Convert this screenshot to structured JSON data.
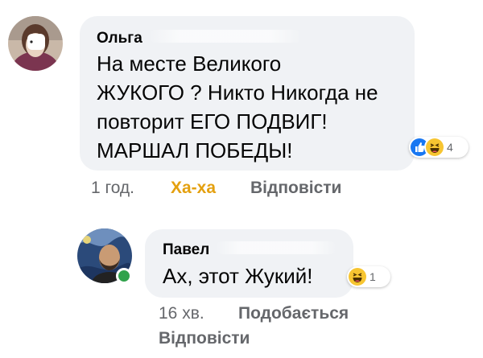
{
  "comments": [
    {
      "author": "Ольга",
      "text_lines": [
        "На месте Великого",
        "ЖУКОГО ? Никто Никогда не",
        "повторит ЕГО ПОДВИГ!",
        "МАРШАЛ ПОБЕДЫ!"
      ],
      "time": "1 год.",
      "reaction_label": "Ха-ха",
      "reply_label": "Відповісти",
      "reactions": {
        "icons": [
          "like-icon",
          "haha-icon"
        ],
        "count": "4"
      }
    },
    {
      "author": "Павел",
      "text": "Ах, этот Жукий!",
      "time": "16 хв.",
      "like_label": "Подобається",
      "reply_label": "Відповісти",
      "reactions": {
        "icons": [
          "haha-icon"
        ],
        "count": "1"
      }
    }
  ],
  "colors": {
    "bubble": "#f0f2f5",
    "meta_text": "#65676b",
    "haha_active": "#e4a00f",
    "like_blue": "#1877f2",
    "online": "#31a24c"
  }
}
